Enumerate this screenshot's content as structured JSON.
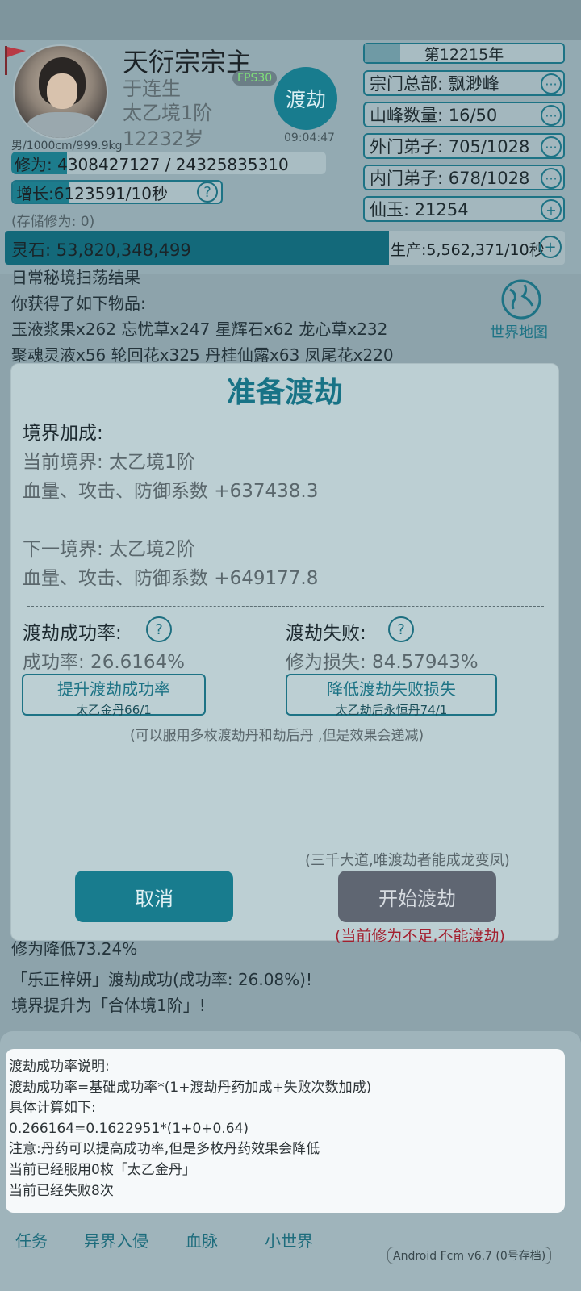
{
  "header": {
    "title": "天衍宗宗主",
    "name": "于连生",
    "realm": "太乙境1阶",
    "age": "12232岁",
    "fps": "FPS30",
    "dujie_button": "渡劫",
    "clock": "09:04:47",
    "body_stats": "男/1000cm/999.9kg"
  },
  "cultivation": {
    "xiuwei_label": "修为: 4308427127 / 24325835310",
    "xiuwei_progress": 0.177,
    "growth_label": "增长:6123591/10秒",
    "growth_progress": 0.27,
    "stored": "(存储修为: 0)",
    "help_glyph": "?"
  },
  "sect": {
    "year": "第12215年",
    "hq": "宗门总部: 飘渺峰",
    "peaks": "山峰数量: 16/50",
    "outer": "外门弟子: 705/1028",
    "inner": "内门弟子: 678/1028",
    "jade": "仙玉: 21254",
    "more_glyph": "···",
    "plus_glyph": "+"
  },
  "spirit_stone": {
    "label": "灵石: 53,820,348,499",
    "production": "生产:5,562,371/10秒",
    "progress": 0.686
  },
  "log": {
    "line0": "日常秘境扫荡结果",
    "line1": "你获得了如下物品:",
    "line2": "玉液浆果x262 忘忧草x247 星辉石x62 龙心草x232",
    "line3": "聚魂灵液x56 轮回花x325 丹桂仙露x63 凤尾花x220",
    "line4": "修为降低73.24%",
    "line5": "「乐正梓妍」渡劫成功(成功率: 26.08%)!",
    "line6": "境界提升为「合体境1阶」!"
  },
  "world_map": {
    "label": "世界地图"
  },
  "modal": {
    "title": "准备渡劫",
    "realm_bonus_header": "境界加成:",
    "current_realm": "当前境界: 太乙境1阶",
    "current_coef": "血量、攻击、防御系数 +637438.3",
    "next_realm": "下一境界:  太乙境2阶",
    "next_coef": "血量、攻击、防御系数 +649177.8",
    "success_header": "渡劫成功率:",
    "success_rate": "成功率:  26.6164%",
    "fail_header": "渡劫失败:",
    "fail_loss": "修为损失:  84.57943%",
    "improve_btn": "提升渡劫成功率",
    "improve_pill": "太乙金丹66/1",
    "reduce_btn": "降低渡劫失败损失",
    "reduce_pill": "太乙劫后永恒丹74/1",
    "note": "(可以服用多枚渡劫丹和劫后丹 ,但是效果会递减)",
    "motto": "(三千大道,唯渡劫者能成龙变凤)",
    "cancel": "取消",
    "start": "开始渡劫",
    "warning": "(当前修为不足,不能渡劫)"
  },
  "tooltip": {
    "line1": "渡劫成功率说明:",
    "line2": "渡劫成功率=基础成功率*(1+渡劫丹药加成+失败次数加成)",
    "line3": "具体计算如下:",
    "line4": "0.266164=0.1622951*(1+0+0.64)",
    "line5": "注意:丹药可以提高成功率,但是多枚丹药效果会降低",
    "line6": "当前已经服用0枚「太乙金丹」",
    "line7": "当前已经失败8次"
  },
  "nav": {
    "tasks": "任务",
    "invasion": "异界入侵",
    "bloodline": "血脉",
    "small_world": "小世界"
  },
  "version": "Android Fcm v6.7 (0号存档)",
  "colors": {
    "accent": "#187c8e",
    "warning": "#a21f2e",
    "disabled": "#5f6672"
  }
}
